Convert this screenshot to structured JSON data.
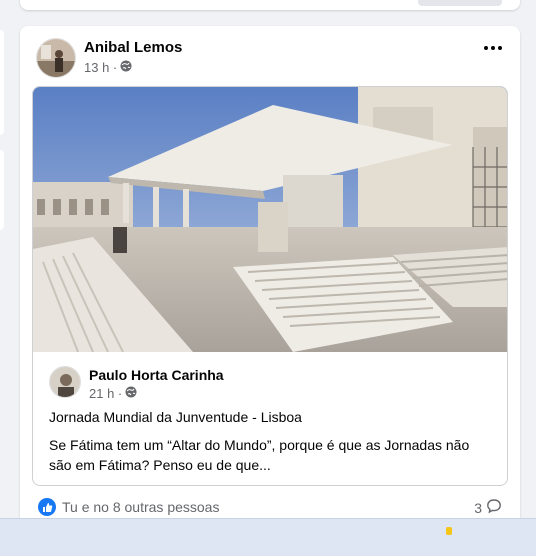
{
  "post": {
    "author": "Anibal Lemos",
    "time": "13 h ·",
    "shared": {
      "author": "Paulo Horta Carinha",
      "time": "21 h ·",
      "line1": "Jornada Mundial da Junventude - Lisboa",
      "text": "Se Fátima tem um “Altar do Mundo”, porque é que as Jornadas não são em Fátima? Penso eu de que..."
    },
    "reactions": "Tu e no 8 outras pessoas",
    "comments_count": "3"
  },
  "colors": {
    "accent": "#1877f2",
    "meta": "#65676b",
    "card_bg": "#ffffff",
    "page_bg": "#f0f2f5"
  },
  "icons": {
    "privacy": "globe-icon",
    "reaction": "like-icon",
    "comments": "comment-icon",
    "menu": "more-options-icon"
  }
}
